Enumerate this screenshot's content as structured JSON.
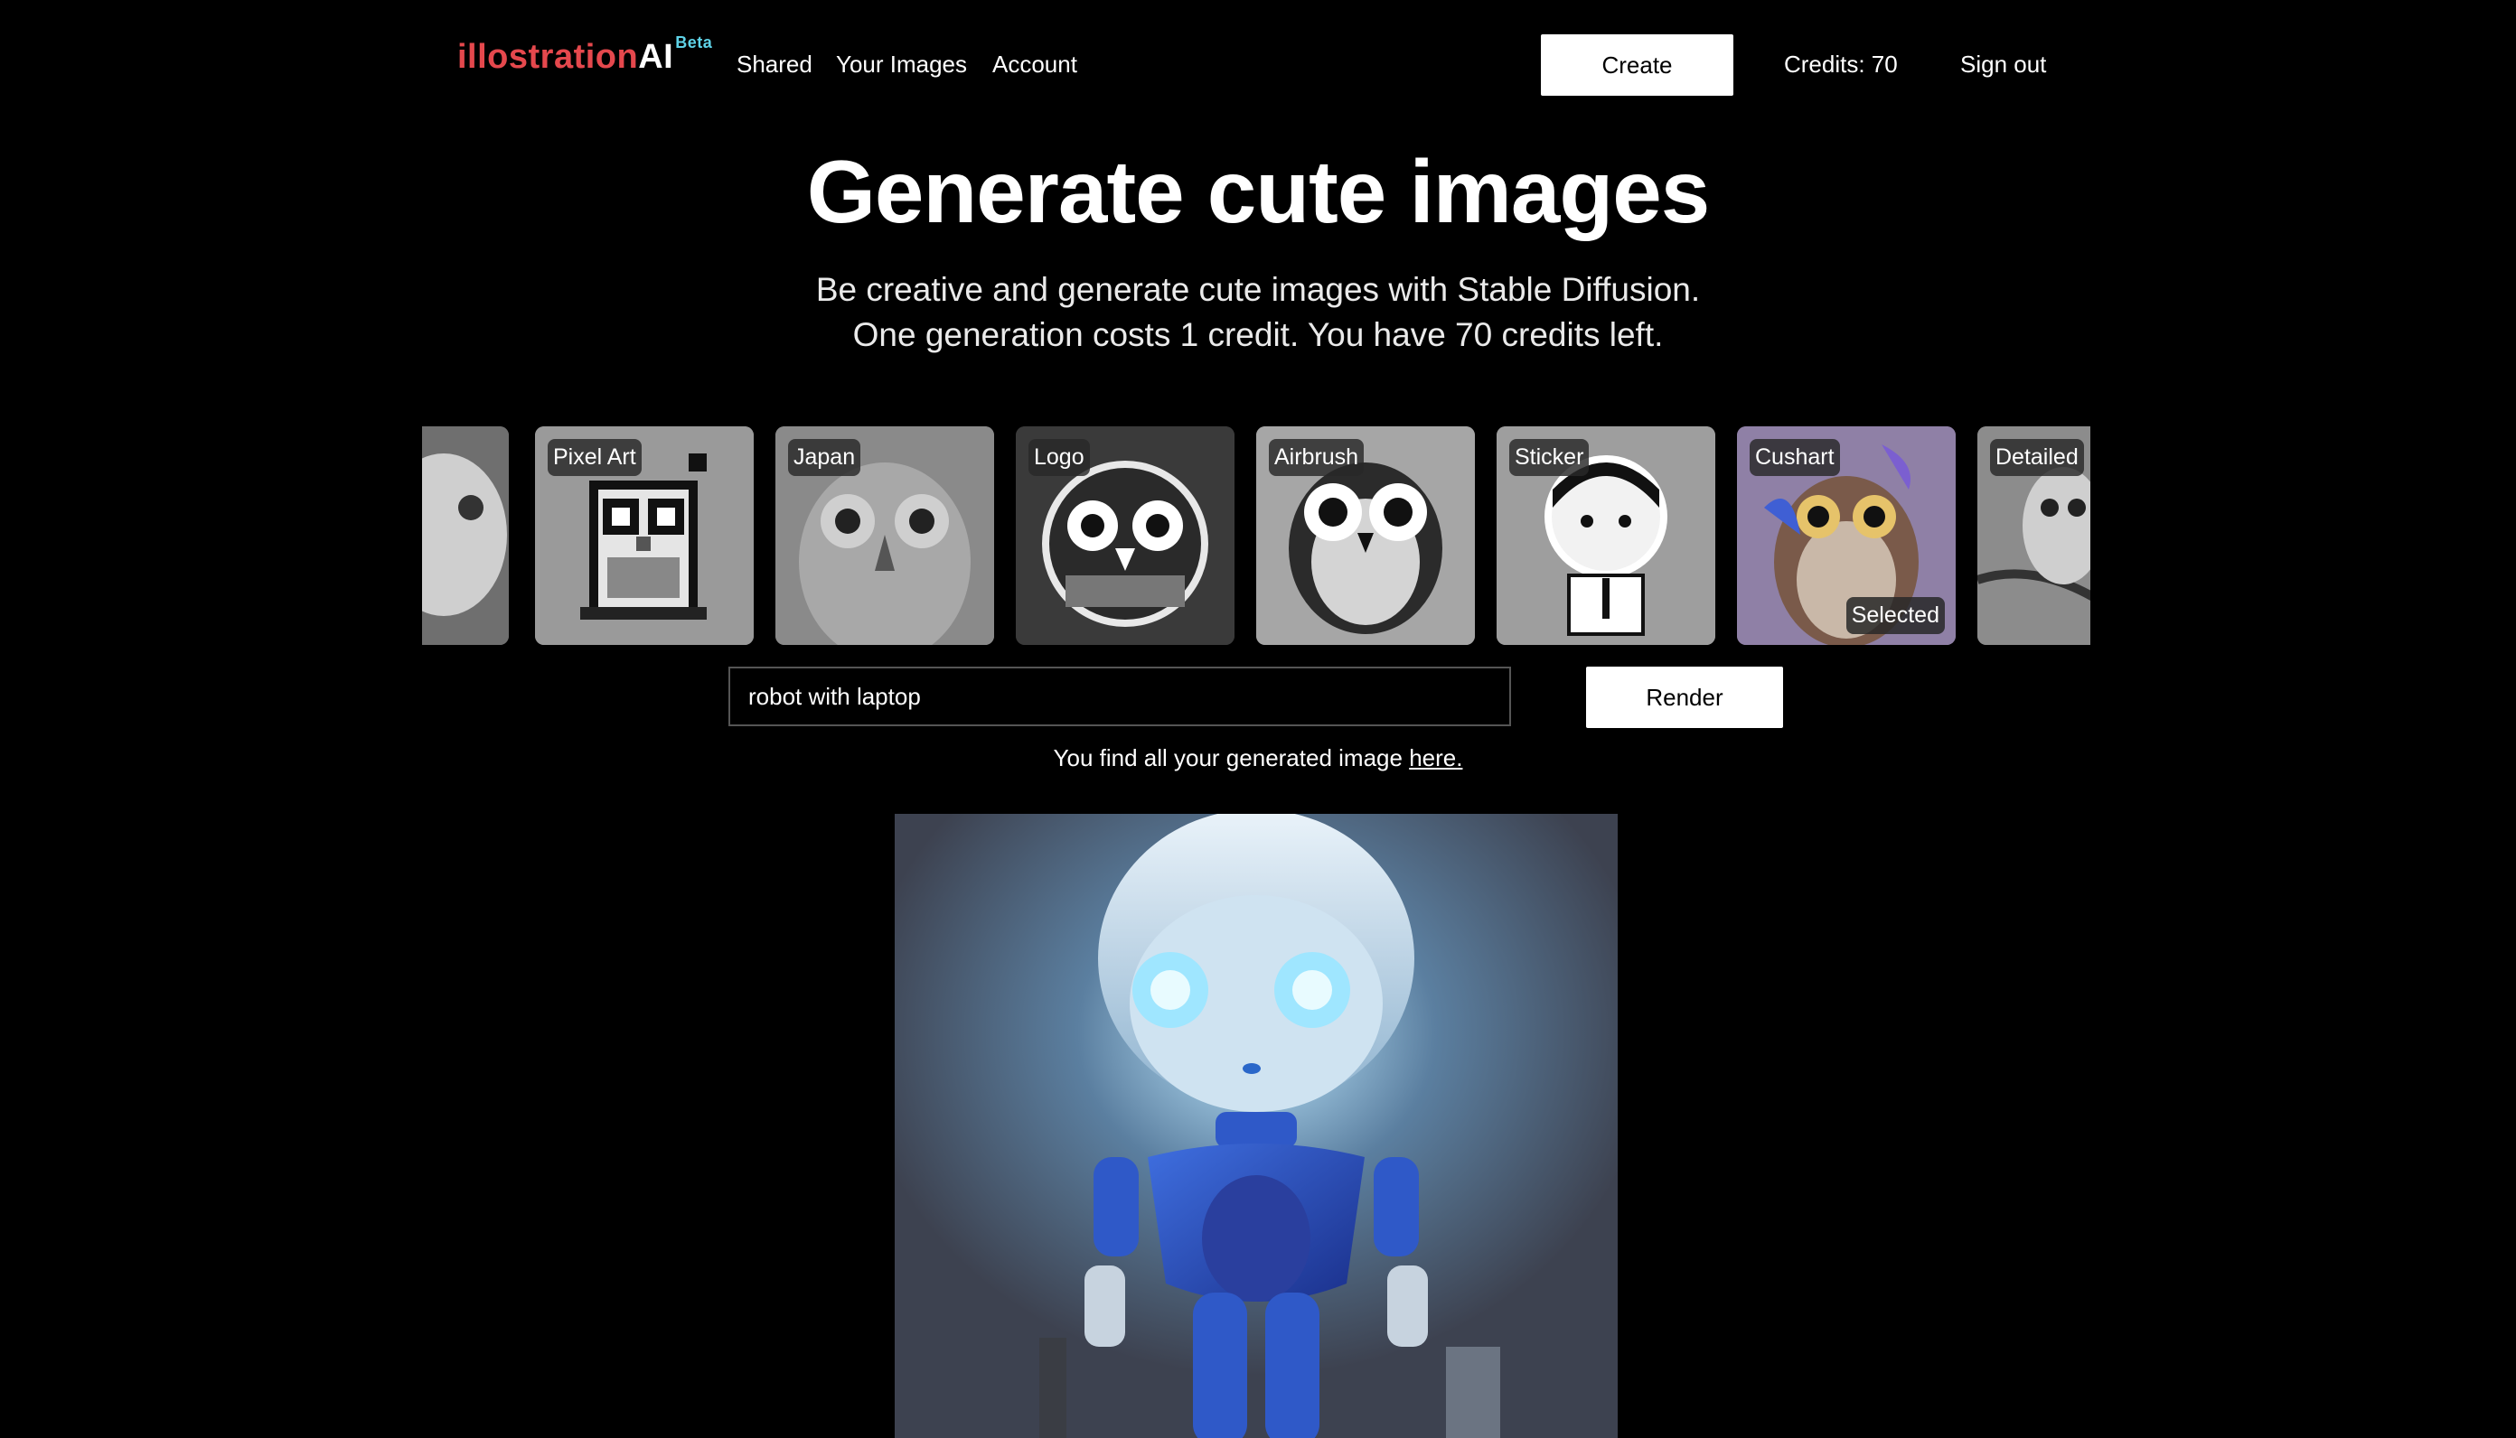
{
  "nav": {
    "brand_part1": "illostration",
    "brand_part2": "AI",
    "brand_badge": "Beta",
    "links": [
      "Shared",
      "Your Images",
      "Account"
    ],
    "create_label": "Create",
    "credits": "Credits: 70",
    "signout": "Sign out"
  },
  "hero": {
    "title": "Generate cute images",
    "line1": "Be creative and generate cute images with Stable Diffusion.",
    "line2": "One generation costs 1 credit. You have 70 credits left."
  },
  "styles": {
    "items": [
      {
        "label": ""
      },
      {
        "label": "Pixel Art"
      },
      {
        "label": "Japan"
      },
      {
        "label": "Logo"
      },
      {
        "label": "Airbrush"
      },
      {
        "label": "Sticker"
      },
      {
        "label": "Cushart"
      },
      {
        "label": "Detailed"
      }
    ],
    "selected_index": 6,
    "selected_label": "Selected"
  },
  "prompt": {
    "value": "robot with laptop",
    "render_label": "Render"
  },
  "hint": {
    "text": "You find all your generated image ",
    "link": "here."
  },
  "colors": {
    "brand_red": "#e5484d",
    "beta_cyan": "#5fd3e8",
    "background": "#000000"
  }
}
